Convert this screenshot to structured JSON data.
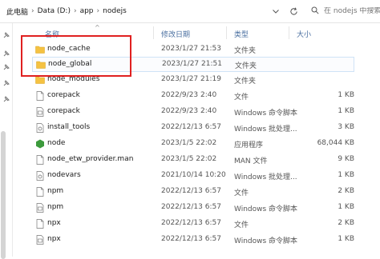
{
  "breadcrumb": [
    "此电脑",
    "Data (D:)",
    "app",
    "nodejs"
  ],
  "search": {
    "placeholder": "在 nodejs 中搜索"
  },
  "columns": {
    "name": "名称",
    "modified": "修改日期",
    "type": "类型",
    "size": "大小"
  },
  "files": [
    {
      "name": "node_cache",
      "modified": "2023/1/27 21:53",
      "type": "文件夹",
      "size": "",
      "icon": "folder-icon",
      "selected": false
    },
    {
      "name": "node_global",
      "modified": "2023/1/27 21:51",
      "type": "文件夹",
      "size": "",
      "icon": "folder-icon",
      "selected": true
    },
    {
      "name": "node_modules",
      "modified": "2023/1/27 21:19",
      "type": "文件夹",
      "size": "",
      "icon": "folder-icon",
      "selected": false
    },
    {
      "name": "corepack",
      "modified": "2022/9/23 2:40",
      "type": "文件",
      "size": "1 KB",
      "icon": "file-icon",
      "selected": false
    },
    {
      "name": "corepack",
      "modified": "2022/9/23 2:40",
      "type": "Windows 命令脚本",
      "size": "1 KB",
      "icon": "file-icon",
      "selected": false
    },
    {
      "name": "install_tools",
      "modified": "2022/12/13 6:57",
      "type": "Windows 批处理...",
      "size": "3 KB",
      "icon": "batch-file-icon",
      "selected": false
    },
    {
      "name": "node",
      "modified": "2023/1/5 22:02",
      "type": "应用程序",
      "size": "68,044 KB",
      "icon": "node-app-icon",
      "selected": false
    },
    {
      "name": "node_etw_provider.man",
      "modified": "2023/1/5 22:02",
      "type": "MAN 文件",
      "size": "9 KB",
      "icon": "file-icon",
      "selected": false
    },
    {
      "name": "nodevars",
      "modified": "2021/10/14 10:20",
      "type": "Windows 批处理...",
      "size": "1 KB",
      "icon": "batch-file-icon",
      "selected": false
    },
    {
      "name": "npm",
      "modified": "2022/12/13 6:57",
      "type": "文件",
      "size": "2 KB",
      "icon": "file-icon",
      "selected": false
    },
    {
      "name": "npm",
      "modified": "2022/12/13 6:57",
      "type": "Windows 命令脚本",
      "size": "1 KB",
      "icon": "file-icon",
      "selected": false
    },
    {
      "name": "npx",
      "modified": "2022/12/13 6:57",
      "type": "文件",
      "size": "2 KB",
      "icon": "file-icon",
      "selected": false
    },
    {
      "name": "npx",
      "modified": "2022/12/13 6:57",
      "type": "Windows 命令脚本",
      "size": "1 KB",
      "icon": "file-icon",
      "selected": false
    }
  ],
  "colors": {
    "folder": "#f5c242",
    "highlight": "#e02020",
    "node_green": "#3c9a3c",
    "header_text": "#4a6fa0"
  }
}
